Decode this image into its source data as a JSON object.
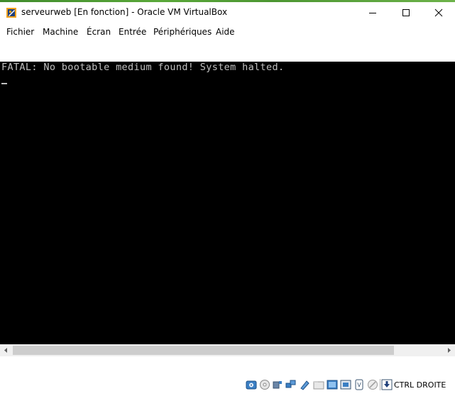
{
  "window": {
    "title": "serveurweb [En fonction] - Oracle VM VirtualBox",
    "app_icon": "virtualbox-icon"
  },
  "menu": {
    "items": [
      "Fichier",
      "Machine",
      "Écran",
      "Entrée",
      "Périphériques",
      "Aide"
    ]
  },
  "console": {
    "line1": "FATAL: No bootable medium found! System halted.",
    "text_color": "#c0c0c0",
    "background": "#000000"
  },
  "statusbar": {
    "icons": [
      "hard-disk-icon",
      "optical-drive-icon",
      "audio-icon",
      "network-icon",
      "usb-icon",
      "shared-folders-icon",
      "display-icon",
      "video-capture-icon",
      "cpu-icon",
      "mouse-integration-icon",
      "keyboard-capture-icon"
    ],
    "host_key": "CTRL DROITE"
  }
}
